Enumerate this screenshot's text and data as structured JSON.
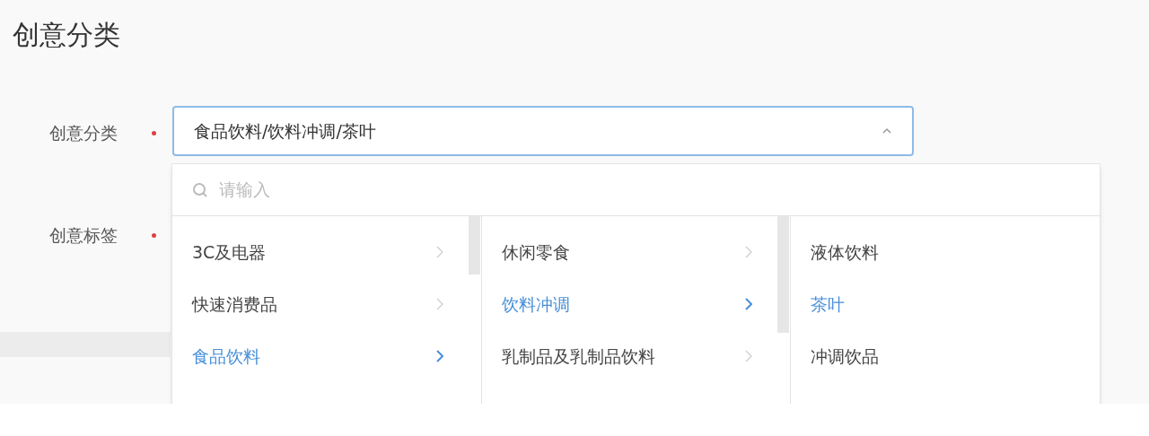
{
  "page_title": "创意分类",
  "fields": [
    {
      "label": "创意分类",
      "required": true
    },
    {
      "label": "创意标签",
      "required": true
    }
  ],
  "select": {
    "value": "食品饮料/饮料冲调/茶叶",
    "expanded": true
  },
  "cascader": {
    "search": {
      "placeholder": "请输入"
    },
    "columns": [
      {
        "items": [
          {
            "label": "3C及电器",
            "has_children": true,
            "selected": false
          },
          {
            "label": "快速消费品",
            "has_children": true,
            "selected": false
          },
          {
            "label": "食品饮料",
            "has_children": true,
            "selected": true
          }
        ]
      },
      {
        "items": [
          {
            "label": "休闲零食",
            "has_children": true,
            "selected": false
          },
          {
            "label": "饮料冲调",
            "has_children": true,
            "selected": true
          },
          {
            "label": "乳制品及乳制品饮料",
            "has_children": true,
            "selected": false
          }
        ]
      },
      {
        "items": [
          {
            "label": "液体饮料",
            "has_children": false,
            "selected": false
          },
          {
            "label": "茶叶",
            "has_children": false,
            "selected": true
          },
          {
            "label": "冲调饮品",
            "has_children": false,
            "selected": false
          }
        ]
      }
    ]
  }
}
